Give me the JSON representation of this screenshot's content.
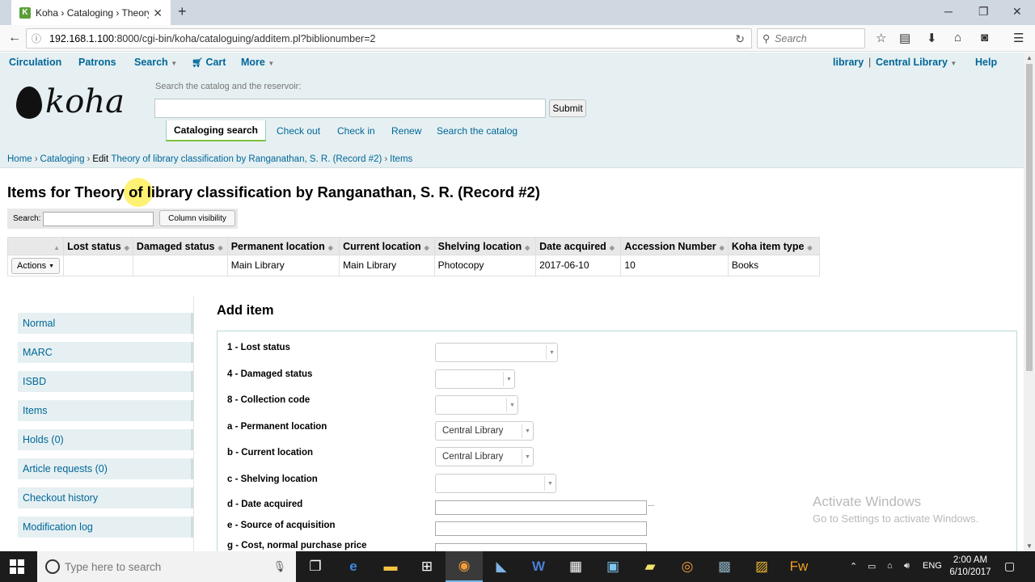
{
  "browser": {
    "tab_title": "Koha › Cataloging › Theory o",
    "favicon_letter": "K",
    "url_host": "192.168.1.100",
    "url_rest": ":8000/cgi-bin/koha/cataloguing/additem.pl?biblionumber=2",
    "search_placeholder": "Search"
  },
  "topnav": {
    "circulation": "Circulation",
    "patrons": "Patrons",
    "search": "Search",
    "cart": "Cart",
    "more": "More",
    "library": "library",
    "sep": "|",
    "branch": "Central Library",
    "help": "Help"
  },
  "header": {
    "logo": "koha",
    "search_label": "Search the catalog and the reservoir:",
    "submit": "Submit",
    "tab_active": "Cataloging search",
    "tab_links": [
      "Check out",
      "Check in",
      "Renew",
      "Search the catalog"
    ]
  },
  "breadcrumb": {
    "home": "Home",
    "cataloging": "Cataloging",
    "edit_prefix": "Edit",
    "record": "Theory of library classification by Ranganathan, S. R. (Record #2)",
    "items": "Items",
    "sep": "›"
  },
  "page_title": "Items for Theory of library classification by Ranganathan, S. R. (Record #2)",
  "table_toolbar": {
    "search_label": "Search:",
    "column_visibility": "Column visibility"
  },
  "items_table": {
    "headers": [
      "",
      "Lost status",
      "Damaged status",
      "Permanent location",
      "Current location",
      "Shelving location",
      "Date acquired",
      "Accession Number",
      "Koha item type"
    ],
    "rows": [
      [
        "Actions",
        "",
        "",
        "Main Library",
        "Main Library",
        "Photocopy",
        "2017-06-10",
        "10",
        "Books"
      ]
    ]
  },
  "sidebar": [
    "Normal",
    "MARC",
    "ISBD",
    "Items",
    "Holds (0)",
    "Article requests (0)",
    "Checkout history",
    "Modification log"
  ],
  "add_item": {
    "title": "Add item",
    "fields": [
      {
        "label": "1 - Lost status",
        "value": ""
      },
      {
        "label": "4 - Damaged status",
        "value": ""
      },
      {
        "label": "8 - Collection code",
        "value": ""
      },
      {
        "label": "a - Permanent location",
        "value": "Central Library"
      },
      {
        "label": "b - Current location",
        "value": "Central Library"
      },
      {
        "label": "c - Shelving location",
        "value": ""
      },
      {
        "label": "d - Date acquired",
        "value": ""
      },
      {
        "label": "e - Source of acquisition",
        "value": ""
      },
      {
        "label": "g - Cost, normal purchase price",
        "value": ""
      }
    ],
    "date_dots": "..."
  },
  "watermark": {
    "line1": "Activate Windows",
    "line2": "Go to Settings to activate Windows."
  },
  "taskbar": {
    "search_placeholder": "Type here to search",
    "lang": "ENG",
    "time": "2:00 AM",
    "date": "6/10/2017"
  }
}
